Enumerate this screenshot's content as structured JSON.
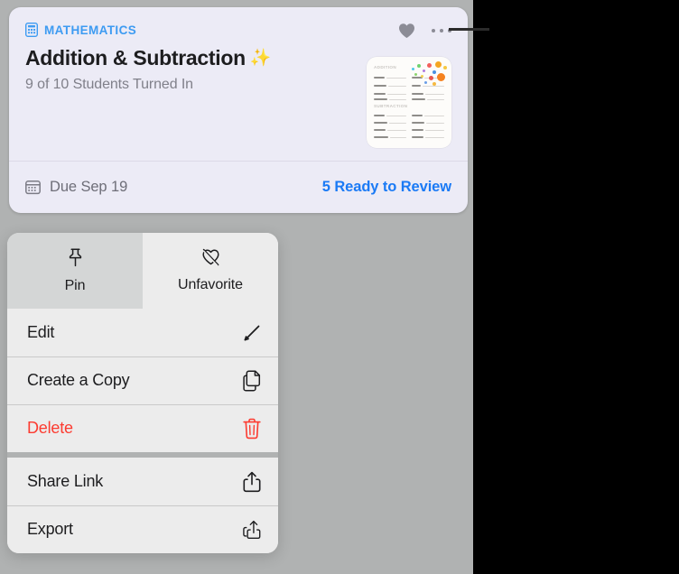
{
  "card": {
    "subject_icon": "calculator-icon",
    "subject": "MATHEMATICS",
    "title": "Addition & Subtraction",
    "title_emoji": "✨",
    "subtitle": "9 of 10 Students Turned In",
    "favorite_icon": "heart-filled-icon",
    "more_icon": "more-ellipsis-icon",
    "thumbnail": {
      "name": "worksheet-thumbnail",
      "heading_1": "ADDITION",
      "heading_2": "SUBTRACTION"
    },
    "footer": {
      "calendar_icon": "calendar-icon",
      "due_text": "Due Sep 19",
      "review_link": "5 Ready to Review"
    }
  },
  "context_menu": {
    "top_actions": [
      {
        "label": "Pin",
        "icon": "pin-icon",
        "selected": false
      },
      {
        "label": "Unfavorite",
        "icon": "heart-slash-icon",
        "selected": true
      }
    ],
    "groups": [
      [
        {
          "label": "Edit",
          "icon": "pencil-icon",
          "danger": false
        },
        {
          "label": "Create a Copy",
          "icon": "duplicate-icon",
          "danger": false
        },
        {
          "label": "Delete",
          "icon": "trash-icon",
          "danger": true
        }
      ],
      [
        {
          "label": "Share Link",
          "icon": "share-icon",
          "danger": false
        },
        {
          "label": "Export",
          "icon": "export-icon",
          "danger": false
        }
      ]
    ]
  },
  "colors": {
    "card_background": "#ecebf6",
    "accent_blue": "#1a7af5",
    "subject_blue": "#3d9bf2",
    "danger_red": "#fc3b30",
    "backdrop_gray": "#b0b2b2",
    "menu_background": "#ececec",
    "menu_selected": "#d4d6d6"
  }
}
